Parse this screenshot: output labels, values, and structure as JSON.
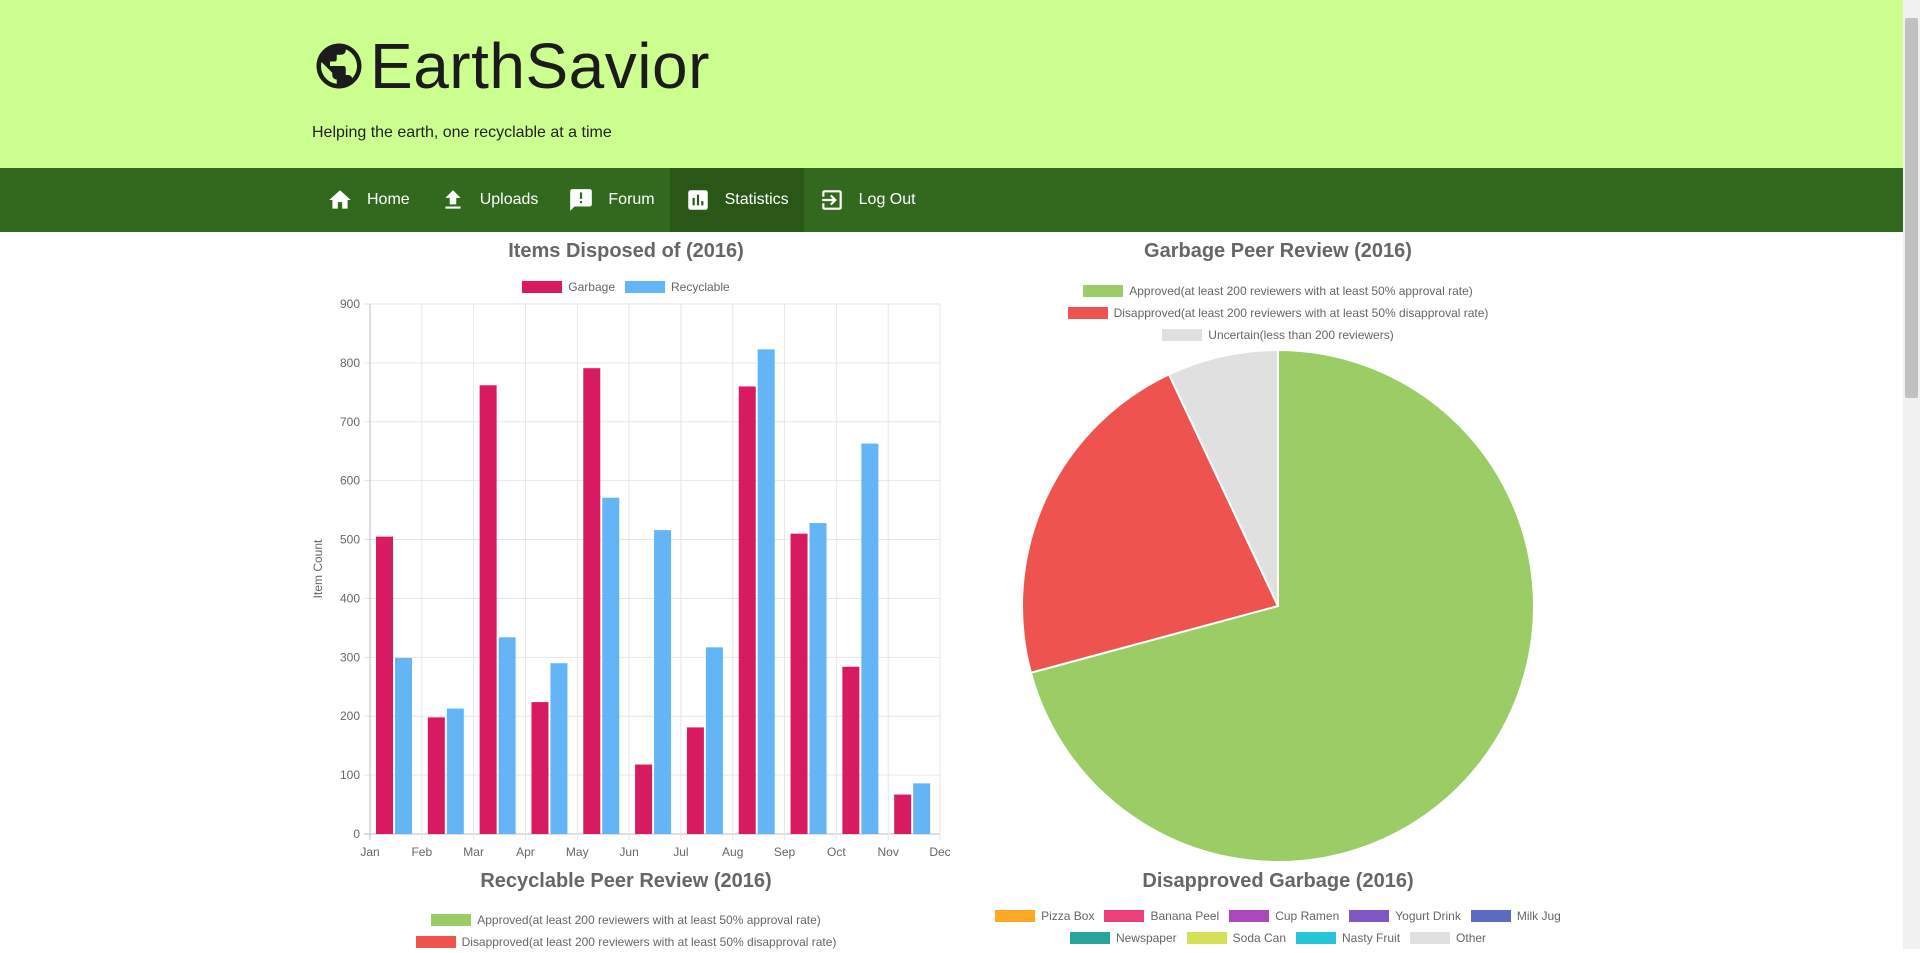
{
  "app": {
    "title": "EarthSavior",
    "tagline": "Helping the earth, one recyclable at a time",
    "logo_icon": "globe-icon"
  },
  "nav": {
    "items": [
      {
        "label": "Home",
        "icon": "home-icon",
        "active": false
      },
      {
        "label": "Uploads",
        "icon": "upload-icon",
        "active": false
      },
      {
        "label": "Forum",
        "icon": "forum-icon",
        "active": false
      },
      {
        "label": "Statistics",
        "icon": "bar-chart-icon",
        "active": true
      },
      {
        "label": "Log Out",
        "icon": "logout-icon",
        "active": false
      }
    ]
  },
  "colors": {
    "header_bg": "#ccff90",
    "nav_bg": "#33691e",
    "garbage": "#d81b60",
    "recyclable": "#64b5f6",
    "approved": "#9ccc65",
    "disapproved": "#ef5350",
    "uncertain": "#e0e0e0"
  },
  "chart_data": [
    {
      "type": "bar",
      "title": "Items Disposed of (2016)",
      "ylabel": "Item Count",
      "xlabel": "",
      "ylim": [
        0,
        900
      ],
      "yticks": [
        0,
        100,
        200,
        300,
        400,
        500,
        600,
        700,
        800,
        900
      ],
      "categories": [
        "Jan",
        "Feb",
        "Mar",
        "Apr",
        "May",
        "Jun",
        "Jul",
        "Aug",
        "Sep",
        "Oct",
        "Nov",
        "Dec"
      ],
      "series": [
        {
          "name": "Garbage",
          "color": "#d81b60",
          "values": [
            505,
            198,
            762,
            224,
            791,
            118,
            181,
            760,
            510,
            284,
            67
          ]
        },
        {
          "name": "Recyclable",
          "color": "#64b5f6",
          "values": [
            299,
            213,
            334,
            290,
            571,
            516,
            317,
            823,
            528,
            663,
            86
          ]
        }
      ],
      "grid": true,
      "legend": "top"
    },
    {
      "type": "pie",
      "title": "Garbage Peer Review (2016)",
      "labels": [
        "Approved(at least 200 reviewers with at least 50% approval rate)",
        "Disapproved(at least 200 reviewers with at least 50% disapproval rate)",
        "Uncertain(less than 200 reviewers)"
      ],
      "colors": [
        "#9ccc65",
        "#ef5350",
        "#e0e0e0"
      ],
      "values": [
        70.8,
        22.2,
        7.0
      ],
      "legend": "top"
    },
    {
      "type": "pie",
      "title": "Recyclable Peer Review (2016)",
      "labels": [
        "Approved(at least 200 reviewers with at least 50% approval rate)",
        "Disapproved(at least 200 reviewers with at least 50% disapproval rate)"
      ],
      "colors": [
        "#9ccc65",
        "#ef5350"
      ],
      "legend": "top"
    },
    {
      "type": "pie",
      "title": "Disapproved Garbage (2016)",
      "labels": [
        "Pizza Box",
        "Banana Peel",
        "Cup Ramen",
        "Yogurt Drink",
        "Milk Jug",
        "Newspaper",
        "Soda Can",
        "Nasty Fruit",
        "Other"
      ],
      "colors": [
        "#ffa726",
        "#ec407a",
        "#ab47bc",
        "#7e57c2",
        "#5c6bc0",
        "#26a69a",
        "#d4e157",
        "#26c6da",
        "#e0e0e0"
      ],
      "legend": "top"
    }
  ]
}
